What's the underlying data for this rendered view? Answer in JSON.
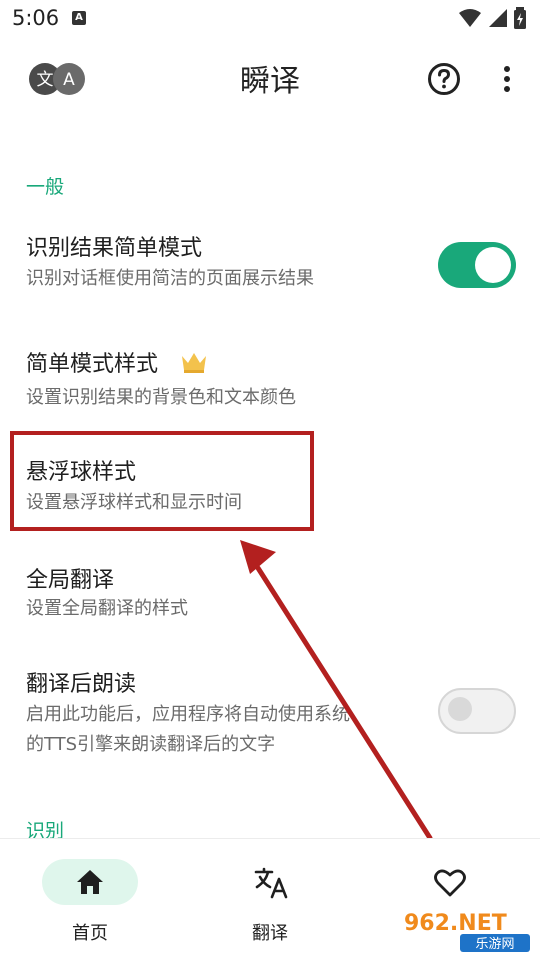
{
  "status_bar": {
    "time": "5:06",
    "notification_letter": "A"
  },
  "app_bar": {
    "title": "瞬译",
    "translate_glyph_1": "文",
    "translate_glyph_2": "A"
  },
  "sections": {
    "general": "一般",
    "recognition": "识别"
  },
  "rows": [
    {
      "title": "识别结果简单模式",
      "subtitle": "识别对话框使用简洁的页面展示结果",
      "toggle": true
    },
    {
      "title": "简单模式样式",
      "subtitle": "设置识别结果的背景色和文本颜色",
      "premium": true
    },
    {
      "title": "悬浮球样式",
      "subtitle": "设置悬浮球样式和显示时间"
    },
    {
      "title": "全局翻译",
      "subtitle": "设置全局翻译的样式"
    },
    {
      "title": "翻译后朗读",
      "subtitle_line1": "启用此功能后，应用程序将自动使用系统",
      "subtitle_line2": "的TTS引擎来朗读翻译后的文字",
      "toggle": false
    }
  ],
  "bottom_nav": {
    "items": [
      {
        "label": "首页",
        "active": true
      },
      {
        "label": "翻译",
        "active": false
      }
    ]
  },
  "watermark": {
    "brand": "962.NET",
    "sub": "乐游网"
  },
  "colors": {
    "accent": "#19a87a",
    "highlight": "#b3201f",
    "arrow": "#b3201f",
    "crown": "#f3c24c"
  }
}
